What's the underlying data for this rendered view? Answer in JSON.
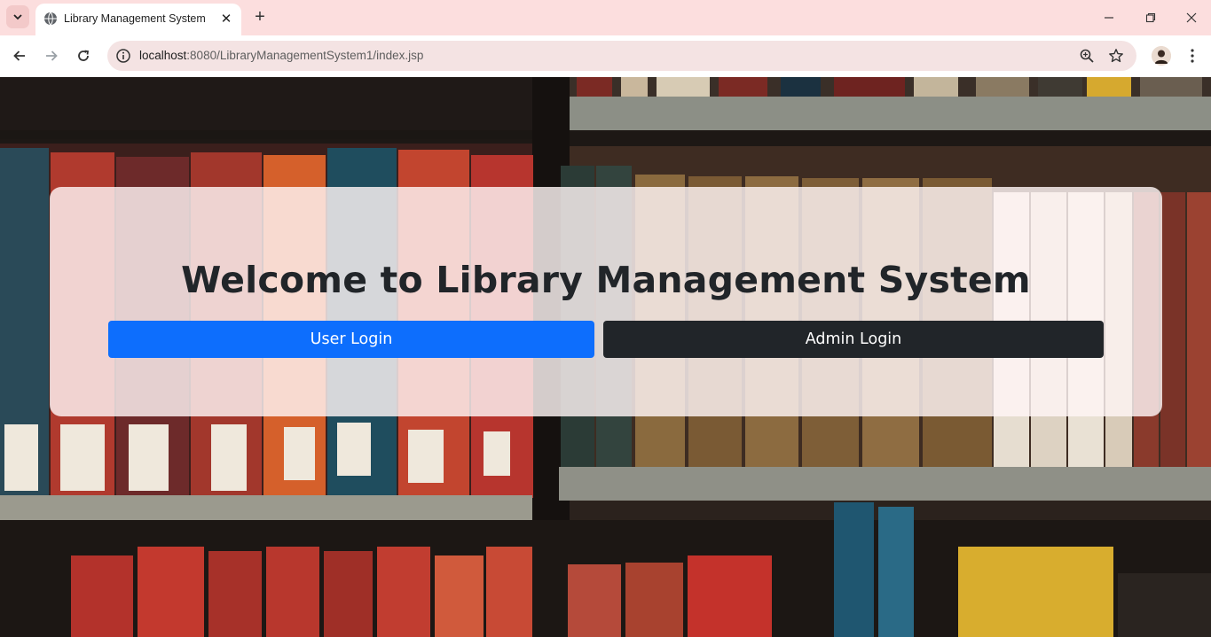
{
  "browser": {
    "tab_title": "Library Management System",
    "tab_close": "✕",
    "new_tab": "+",
    "url_host": "localhost",
    "url_path": ":8080/LibraryManagementSystem1/index.jsp"
  },
  "page": {
    "heading": "Welcome to Library Management System",
    "user_login_label": "User Login",
    "admin_login_label": "Admin Login"
  },
  "colors": {
    "tabbar": "#fcdede",
    "primary_button": "#0d6efd",
    "dark_button": "#212529"
  }
}
